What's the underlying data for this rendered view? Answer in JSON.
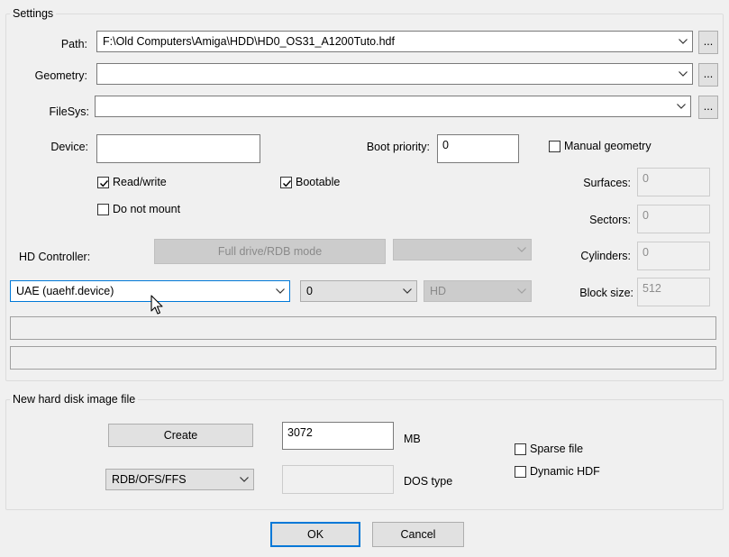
{
  "settings": {
    "title": "Settings",
    "path_label": "Path:",
    "path_value": "F:\\Old Computers\\Amiga\\HDD\\HD0_OS31_A1200Tuto.hdf",
    "geometry_label": "Geometry:",
    "geometry_value": "",
    "filesys_label": "FileSys:",
    "filesys_value": "",
    "browse_label": "...",
    "device_label": "Device:",
    "device_value": "",
    "boot_priority_label": "Boot priority:",
    "boot_priority_value": "0",
    "manual_geometry_label": "Manual geometry",
    "manual_geometry_checked": false,
    "read_write_label": "Read/write",
    "read_write_checked": true,
    "bootable_label": "Bootable",
    "bootable_checked": true,
    "do_not_mount_label": "Do not mount",
    "do_not_mount_checked": false,
    "surfaces_label": "Surfaces:",
    "surfaces_value": "0",
    "sectors_label": "Sectors:",
    "sectors_value": "0",
    "cylinders_label": "Cylinders:",
    "cylinders_value": "0",
    "block_size_label": "Block size:",
    "block_size_value": "512",
    "hd_controller_label": "HD Controller:",
    "full_drive_button": "Full drive/RDB mode",
    "controller_value": "UAE (uaehf.device)",
    "unit_value": "0",
    "type_value": "HD",
    "info_line_1": "",
    "info_line_2": ""
  },
  "new_image": {
    "title": "New hard disk image file",
    "create_button": "Create",
    "size_value": "3072",
    "size_unit": "MB",
    "sparse_label": "Sparse file",
    "sparse_checked": false,
    "dynamic_label": "Dynamic HDF",
    "dynamic_checked": false,
    "format_value": "RDB/OFS/FFS",
    "dos_type_value": "",
    "dos_type_label": "DOS type"
  },
  "footer": {
    "ok_label": "OK",
    "cancel_label": "Cancel"
  },
  "colors": {
    "window_bg": "#f0f0f0",
    "focus_accent": "#0078d7",
    "button_bg": "#e1e1e1",
    "disabled_bg": "#cccccc"
  }
}
